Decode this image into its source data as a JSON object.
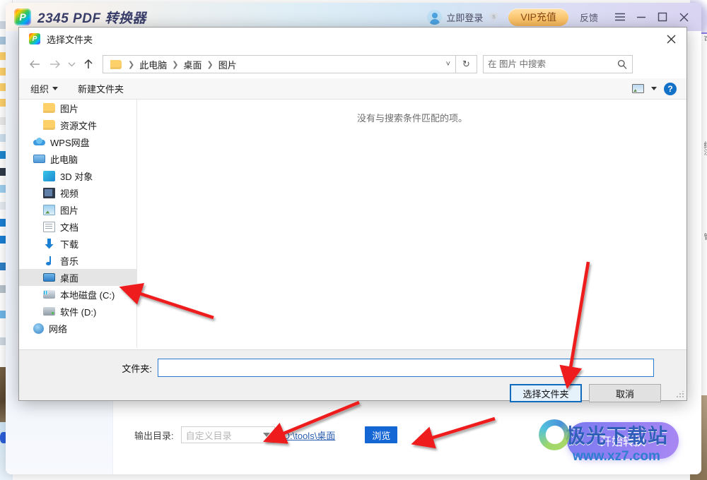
{
  "app": {
    "title": "2345 PDF 转换器",
    "logo_letter": "P",
    "login_label": "立即登录",
    "vip_label": "VIP充值",
    "feedback_label": "反馈",
    "menu_icon": "hamburger-icon",
    "minimize_icon": "minimize-icon",
    "maximize_icon": "maximize-icon",
    "close_icon": "close-icon",
    "output": {
      "label": "输出目录:",
      "select_value": "自定义目录",
      "path_link": "D:\\tools\\桌面",
      "browse_label": "浏览"
    },
    "start_button": "开始转换"
  },
  "watermark": {
    "cn": "极光下载站",
    "url": "www.xz7.com"
  },
  "dialog": {
    "title": "选择文件夹",
    "close_icon": "close-icon",
    "nav": {
      "back_icon": "arrow-left-icon",
      "forward_icon": "arrow-right-icon",
      "recent_icon": "chevron-down-icon",
      "up_icon": "arrow-up-icon",
      "refresh_icon": "refresh-icon",
      "breadcrumbs": [
        "此电脑",
        "桌面",
        "图片"
      ],
      "breadcrumb_caret_icon": "chevron-down-icon"
    },
    "search": {
      "placeholder": "在 图片 中搜索",
      "value": "",
      "icon": "search-icon"
    },
    "commandbar": {
      "organize_label": "组织",
      "new_folder_label": "新建文件夹",
      "view_icon": "view-layout-icon",
      "view_caret_icon": "chevron-down-icon",
      "help_icon": "help-icon",
      "help_glyph": "?"
    },
    "tree": [
      {
        "label": "图片",
        "icon": "folder-icon",
        "indent": 34,
        "iconclass": "folder-ico",
        "selected": false
      },
      {
        "label": "资源文件",
        "icon": "folder-icon",
        "indent": 34,
        "iconclass": "folder-ico",
        "selected": false
      },
      {
        "label": "WPS网盘",
        "icon": "cloud-icon",
        "indent": 20,
        "iconclass": "cloud-ico",
        "selected": false
      },
      {
        "label": "此电脑",
        "icon": "this-pc-icon",
        "indent": 20,
        "iconclass": "pc-ico",
        "selected": false
      },
      {
        "label": "3D 对象",
        "icon": "3d-objects-icon",
        "indent": 34,
        "iconclass": "d3-ico",
        "selected": false
      },
      {
        "label": "视频",
        "icon": "videos-icon",
        "indent": 34,
        "iconclass": "vid-ico",
        "selected": false
      },
      {
        "label": "图片",
        "icon": "pictures-icon",
        "indent": 34,
        "iconclass": "pic-ico",
        "selected": false
      },
      {
        "label": "文档",
        "icon": "documents-icon",
        "indent": 34,
        "iconclass": "doc-ico",
        "selected": false
      },
      {
        "label": "下载",
        "icon": "downloads-icon",
        "indent": 34,
        "iconclass": "dl-ico",
        "selected": false
      },
      {
        "label": "音乐",
        "icon": "music-icon",
        "indent": 34,
        "iconclass": "mus-ico",
        "selected": false
      },
      {
        "label": "桌面",
        "icon": "desktop-icon",
        "indent": 34,
        "iconclass": "desk-ico",
        "selected": true
      },
      {
        "label": "本地磁盘 (C:)",
        "icon": "local-disk-c-icon",
        "indent": 34,
        "iconclass": "drvc-ico",
        "selected": false
      },
      {
        "label": "软件 (D:)",
        "icon": "drive-d-icon",
        "indent": 34,
        "iconclass": "drv-ico",
        "selected": false
      },
      {
        "label": "网络",
        "icon": "network-icon",
        "indent": 20,
        "iconclass": "net-ico",
        "selected": false
      }
    ],
    "filelist": {
      "empty_message": "没有与搜索条件匹配的项。"
    },
    "footer": {
      "folder_label": "文件夹:",
      "folder_value": "",
      "select_button": "选择文件夹",
      "cancel_button": "取消"
    }
  },
  "colors": {
    "accent_blue": "#1667d6",
    "dialog_primary_border": "#0f6cbd",
    "annotation_red": "#ee1c1c",
    "start_button": "#8f7ff2",
    "vip_gold": "#f5b457"
  }
}
